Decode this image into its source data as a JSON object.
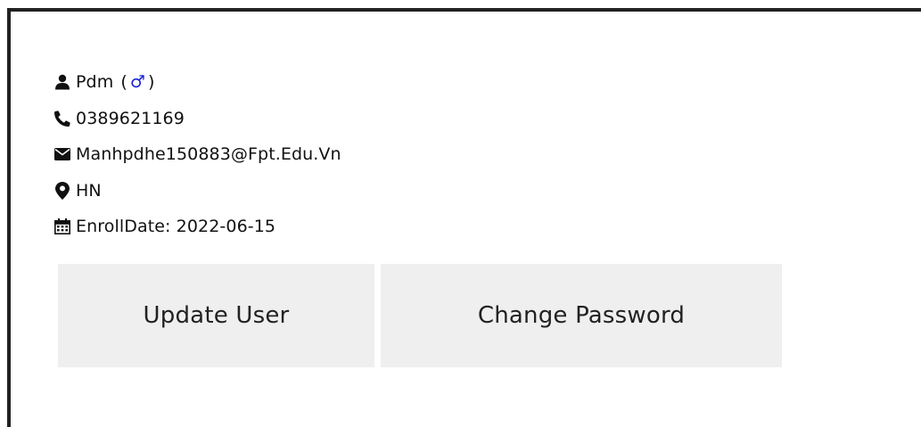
{
  "profile": {
    "name": "Pdm",
    "gender_open": "(",
    "gender_symbol": "♂",
    "gender_close": ")",
    "phone": "0389621169",
    "email": "Manhpdhe150883@Fpt.Edu.Vn",
    "location": "HN",
    "enroll_date": "EnrollDate: 2022-06-15"
  },
  "icons": {
    "name": "user-icon",
    "phone": "phone-icon",
    "email": "envelope-icon",
    "location": "map-marker-icon",
    "enroll": "calendar-icon"
  },
  "colors": {
    "gender_symbol": "#1a23d6",
    "button_bg": "#efefef",
    "border": "#222222"
  },
  "actions": {
    "update_user": "Update User",
    "change_password": "Change Password"
  }
}
